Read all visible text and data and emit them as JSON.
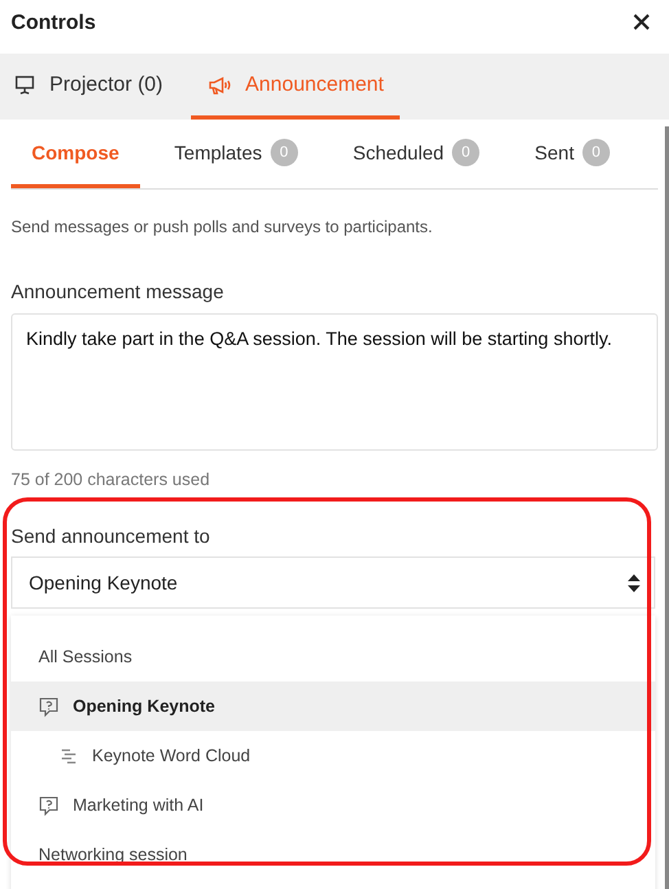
{
  "window": {
    "title": "Controls"
  },
  "tabs": [
    {
      "label": "Projector (0)",
      "kind": "projector",
      "selected": false
    },
    {
      "label": "Announcement",
      "kind": "megaphone",
      "selected": true
    }
  ],
  "subtabs": [
    {
      "label": "Compose",
      "selected": true
    },
    {
      "label": "Templates",
      "count": "0",
      "selected": false
    },
    {
      "label": "Scheduled",
      "count": "0",
      "selected": false
    },
    {
      "label": "Sent",
      "count": "0",
      "selected": false
    }
  ],
  "description": "Send messages or push polls and surveys to participants.",
  "message": {
    "label": "Announcement message",
    "value": "Kindly take part in the Q&A session. The session will be starting shortly.",
    "counter": "75 of 200 characters used"
  },
  "recipient": {
    "label": "Send announcement to",
    "value": "Opening Keynote",
    "highlighted": true,
    "options": [
      {
        "label": "All Sessions",
        "kind": "group",
        "selected": false
      },
      {
        "label": "Opening Keynote",
        "kind": "session",
        "selected": true,
        "children": [
          {
            "label": "Keynote Word Cloud",
            "kind": "activity",
            "selected": false
          }
        ]
      },
      {
        "label": "Marketing with AI",
        "kind": "session",
        "selected": false
      },
      {
        "label": "Networking session",
        "kind": "group",
        "selected": false
      }
    ]
  }
}
